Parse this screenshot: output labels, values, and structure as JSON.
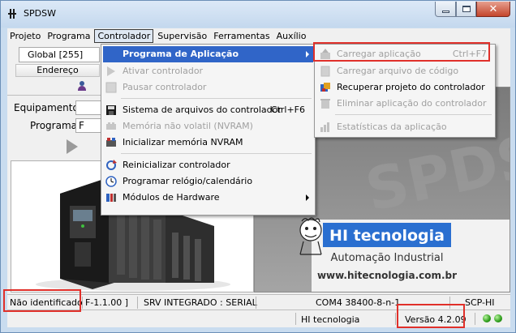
{
  "window": {
    "title": "SPDSW"
  },
  "menubar": {
    "items": [
      "Projeto",
      "Programa",
      "Controlador",
      "Supervisão",
      "Ferramentas",
      "Auxílio"
    ],
    "active_index": 2
  },
  "toolbar": {
    "address_combo": "Global [255]",
    "endereco_label": "Endereço"
  },
  "form": {
    "equipamento_label": "Equipamento",
    "programa_label": "Programa",
    "programa_value": "F"
  },
  "controlador_menu": {
    "items": [
      {
        "label": "Programa de Aplicação",
        "state": "highlighted",
        "has_submenu": true,
        "icon": "none"
      },
      {
        "label": "Ativar controlador",
        "state": "disabled",
        "icon": "play-icon"
      },
      {
        "label": "Pausar controlador",
        "state": "disabled",
        "icon": "pause-icon"
      },
      {
        "label": "Sistema de arquivos do controlador",
        "shortcut": "Ctrl+F6",
        "state": "enabled",
        "icon": "floppy-disk-icon"
      },
      {
        "label": "Memória não volatil (NVRAM)",
        "state": "disabled",
        "icon": "memory-chip-icon"
      },
      {
        "label": "Inicializar memória NVRAM",
        "state": "enabled",
        "icon": "memory-init-icon"
      },
      {
        "label": "Reinicializar controlador",
        "state": "enabled",
        "icon": "restart-icon"
      },
      {
        "label": "Programar relógio/calendário",
        "state": "enabled",
        "icon": "clock-icon"
      },
      {
        "label": "Módulos de Hardware",
        "state": "enabled",
        "has_submenu": true,
        "icon": "hardware-modules-icon"
      }
    ]
  },
  "programa_submenu": {
    "items": [
      {
        "label": "Carregar aplicação",
        "shortcut": "Ctrl+F7",
        "state": "disabled",
        "icon": "upload-app-icon"
      },
      {
        "label": "Carregar arquivo de código",
        "state": "disabled",
        "icon": "upload-file-icon"
      },
      {
        "label": "Recuperar projeto do controlador",
        "state": "enabled",
        "icon": "recover-project-icon"
      },
      {
        "label": "Eliminar aplicação do controlador",
        "state": "disabled",
        "icon": "delete-app-icon"
      },
      {
        "label": "Estatísticas da aplicação",
        "state": "disabled",
        "icon": "statistics-icon"
      }
    ]
  },
  "logo_panel": {
    "brand": "HI tecnologia",
    "tagline": "Automação Industrial",
    "url": "www.hitecnologia.com.br",
    "watermark": "SPDSW"
  },
  "statusbar": {
    "status": "Não identificado",
    "firmware": "F-1.1.00 ]",
    "server": "SRV INTEGRADO : SERIAL",
    "com": "COM4 38400-8-n-1",
    "device": "SCP-HI",
    "company": "HI tecnologia",
    "version": "Versão 4.2.09"
  },
  "colors": {
    "highlight": "#3065c8",
    "annotation_red": "#e0302a",
    "brand_blue": "#2a6fd0"
  }
}
